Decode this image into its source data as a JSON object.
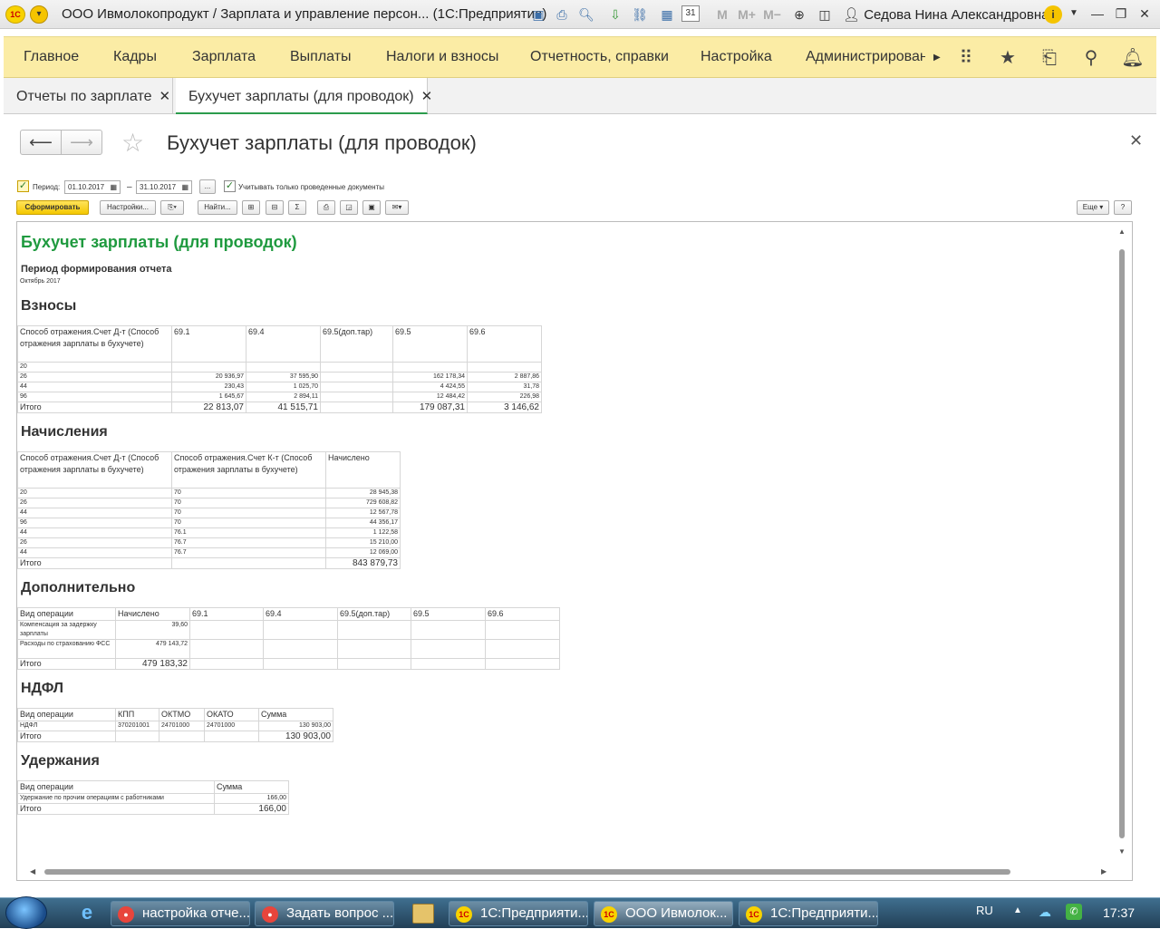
{
  "window": {
    "title": "ООО Ивмолокопродукт / Зарплата и управление персон... (1С:Предприятие)",
    "logo_text": "1С",
    "user": "Седова Нина Александровна",
    "toolbar_icons": [
      "save-icon",
      "print-icon",
      "preview-icon",
      "attach-icon",
      "link-icon",
      "calculator-icon",
      "calendar-icon",
      "memory-m",
      "memory-m-plus",
      "memory-m-minus",
      "zoom-icon",
      "panel-icon"
    ],
    "mem_m": "M",
    "mem_mplus": "M+",
    "mem_mminus": "M−",
    "calendar_day": "31"
  },
  "sections": {
    "items": [
      "Главное",
      "Кадры",
      "Зарплата",
      "Выплаты",
      "Налоги и взносы",
      "Отчетность, справки",
      "Настройка",
      "Администрирован"
    ]
  },
  "tabs": [
    {
      "label": "Отчеты по зарплате",
      "active": false
    },
    {
      "label": "Бухучет зарплаты (для проводок)",
      "active": true
    }
  ],
  "form": {
    "title": "Бухучет зарплаты (для проводок)",
    "period_label": "Период:",
    "date_from": "01.10.2017",
    "date_sep": "–",
    "date_to": "31.10.2017",
    "ellipsis": "...",
    "posted_only_label": "Учитывать только проведенные документы",
    "btn_generate": "Сформировать",
    "btn_settings": "Настройки...",
    "btn_find": "Найти...",
    "btn_more": "Еще",
    "btn_help": "?"
  },
  "report": {
    "title": "Бухучет зарплаты (для проводок)",
    "period_heading": "Период формирования отчета",
    "period_value": "Октябрь 2017",
    "contrib": {
      "heading": "Взносы",
      "col_head": "Способ отражения.Счет Д-т (Способ отражения зарплаты в бухучете)",
      "cols": [
        "69.1",
        "69.4",
        "69.5(доп.тар)",
        "69.5",
        "69.6"
      ],
      "rows": [
        {
          "acc": "20",
          "v": [
            "",
            "",
            "",
            "",
            ""
          ]
        },
        {
          "acc": "26",
          "v": [
            "20 936,97",
            "37 595,90",
            "",
            "162 178,34",
            "2 887,86"
          ]
        },
        {
          "acc": "44",
          "v": [
            "230,43",
            "1 025,70",
            "",
            "4 424,55",
            "31,78"
          ]
        },
        {
          "acc": "96",
          "v": [
            "1 645,67",
            "2 894,11",
            "",
            "12 484,42",
            "226,98"
          ]
        }
      ],
      "total_label": "Итого",
      "totals": [
        "22 813,07",
        "41 515,71",
        "",
        "179 087,31",
        "3 146,62"
      ]
    },
    "accruals": {
      "heading": "Начисления",
      "col1": "Способ отражения.Счет Д-т (Способ отражения зарплаты в бухучете)",
      "col2": "Способ отражения.Счет К-т (Способ отражения зарплаты в бухучете)",
      "col3": "Начислено",
      "rows": [
        {
          "dt": "20",
          "kt": "70",
          "v": "28 945,38"
        },
        {
          "dt": "26",
          "kt": "70",
          "v": "729 608,82"
        },
        {
          "dt": "44",
          "kt": "70",
          "v": "12 567,78"
        },
        {
          "dt": "96",
          "kt": "70",
          "v": "44 356,17"
        },
        {
          "dt": "44",
          "kt": "76.1",
          "v": "1 122,58"
        },
        {
          "dt": "26",
          "kt": "76.7",
          "v": "15 210,00"
        },
        {
          "dt": "44",
          "kt": "76.7",
          "v": "12 069,00"
        }
      ],
      "total_label": "Итого",
      "total": "843 879,73"
    },
    "additional": {
      "heading": "Дополнительно",
      "cols": [
        "Вид операции",
        "Начислено",
        "69.1",
        "69.4",
        "69.5(доп.тар)",
        "69.5",
        "69.6"
      ],
      "rows": [
        {
          "op": "Компенсация за задержку зарплаты",
          "v": "39,60"
        },
        {
          "op": "Расходы по страхованию ФСС",
          "v": "479 143,72"
        }
      ],
      "total_label": "Итого",
      "total": "479 183,32"
    },
    "ndfl": {
      "heading": "НДФЛ",
      "cols": [
        "Вид операции",
        "КПП",
        "ОКТМО",
        "ОКАТО",
        "Сумма"
      ],
      "row": [
        "НДФЛ",
        "370201001",
        "24701000",
        "24701000",
        "130 903,00"
      ],
      "total_label": "Итого",
      "total": "130 903,00"
    },
    "deductions": {
      "heading": "Удержания",
      "cols": [
        "Вид операции",
        "Сумма"
      ],
      "row": [
        "Удержание по прочим операциям с работниками",
        "166,00"
      ],
      "total_label": "Итого",
      "total": "166,00"
    }
  },
  "taskbar": {
    "tasks": [
      "настройка отче...",
      "Задать вопрос ...",
      "1С:Предприяти...",
      "ООО Ивмолок...",
      "1С:Предприяти..."
    ],
    "lang": "RU",
    "time": "17:37"
  }
}
